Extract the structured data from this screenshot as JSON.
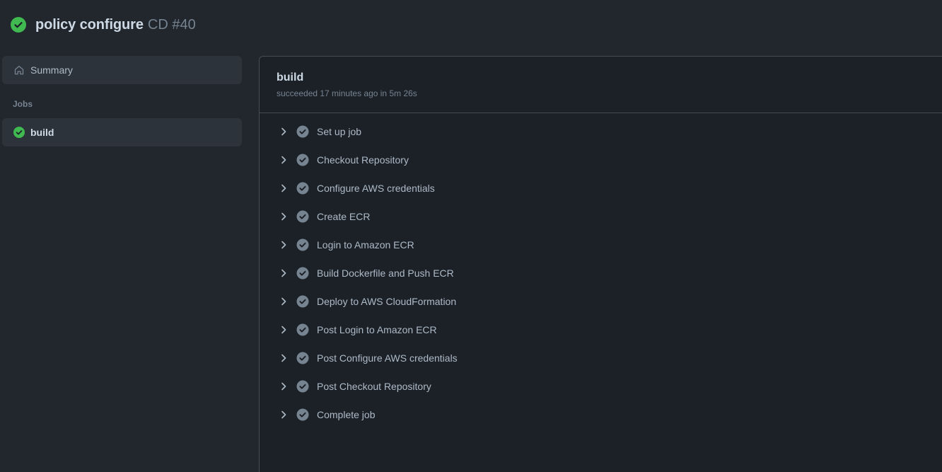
{
  "header": {
    "title": "policy configure",
    "run": "CD #40",
    "status_icon": "check-circle-fill-icon",
    "status_color": "#57ab5a"
  },
  "sidebar": {
    "summary_label": "Summary",
    "summary_icon": "home-icon",
    "jobs_heading": "Jobs",
    "jobs": [
      {
        "label": "build",
        "status_icon": "check-circle-fill-icon"
      }
    ]
  },
  "job": {
    "title": "build",
    "meta": "succeeded 17 minutes ago in 5m 26s",
    "steps": [
      {
        "label": "Set up job"
      },
      {
        "label": "Checkout Repository"
      },
      {
        "label": "Configure AWS credentials"
      },
      {
        "label": "Create ECR"
      },
      {
        "label": "Login to Amazon ECR"
      },
      {
        "label": "Build Dockerfile and Push ECR"
      },
      {
        "label": "Deploy to AWS CloudFormation"
      },
      {
        "label": "Post Login to Amazon ECR"
      },
      {
        "label": "Post Configure AWS credentials"
      },
      {
        "label": "Post Checkout Repository"
      },
      {
        "label": "Complete job"
      }
    ],
    "step_icons": {
      "expand": "chevron-right-icon",
      "status": "check-circle-fill-icon"
    }
  },
  "colors": {
    "background": "#22272e",
    "panel": "#1c2128",
    "success": "#57ab5a",
    "step_success": "#768390"
  }
}
